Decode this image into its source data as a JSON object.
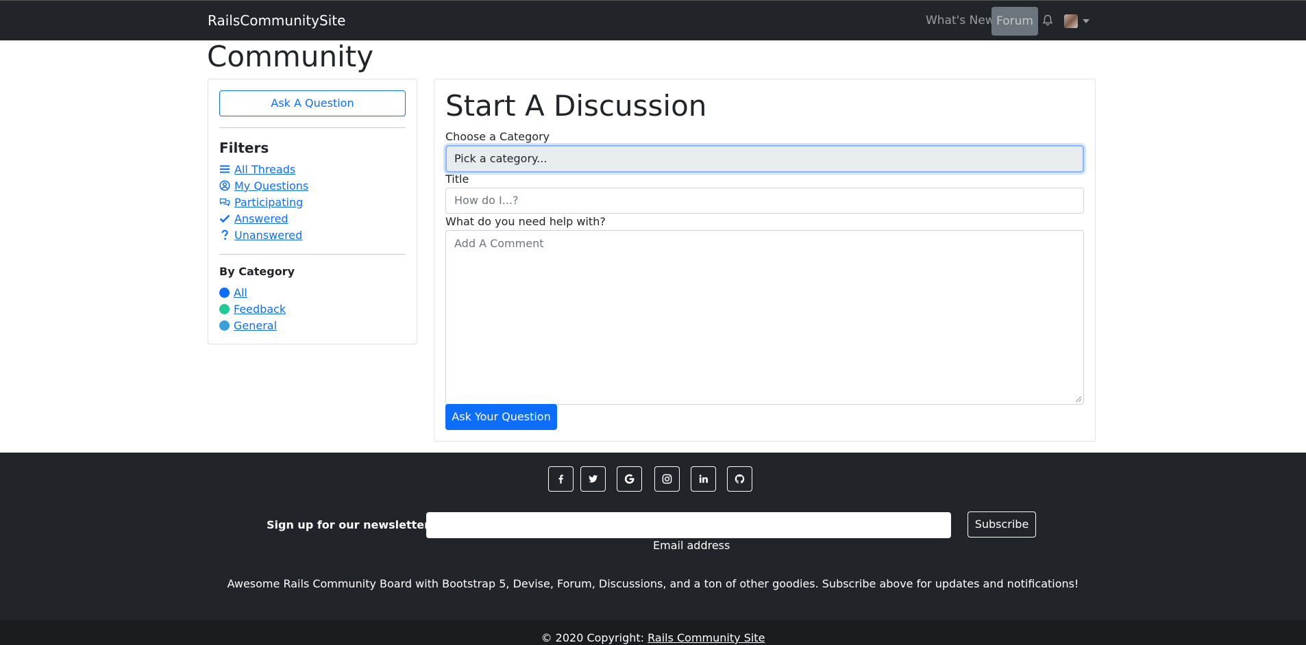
{
  "navbar": {
    "brand": "RailsCommunitySite",
    "whats_new": "What's New",
    "forum": "Forum"
  },
  "page_title": "Community",
  "sidebar": {
    "ask_button": "Ask A Question",
    "filters_title": "Filters",
    "filters": [
      {
        "label": "All Threads",
        "icon": "list-icon"
      },
      {
        "label": "My Questions",
        "icon": "user-circle-icon"
      },
      {
        "label": "Participating",
        "icon": "comments-icon"
      },
      {
        "label": "Answered",
        "icon": "check-icon"
      },
      {
        "label": "Unanswered",
        "icon": "question-icon"
      }
    ],
    "by_category_title": "By Category",
    "categories": [
      {
        "label": "All",
        "color": "#0d6efd"
      },
      {
        "label": "Feedback",
        "color": "#20c997"
      },
      {
        "label": "General",
        "color": "#3ba0d8"
      }
    ]
  },
  "form": {
    "title": "Start A Discussion",
    "category_label": "Choose a Category",
    "category_selected": "Pick a category...",
    "title_label": "Title",
    "title_placeholder": "How do I...?",
    "body_label": "What do you need help with?",
    "body_placeholder": "Add A Comment",
    "submit": "Ask Your Question"
  },
  "footer": {
    "socials": [
      "facebook-icon",
      "twitter-icon",
      "google-icon",
      "instagram-icon",
      "linkedin-icon",
      "github-icon"
    ],
    "newsletter_label": "Sign up for our newsletter",
    "email_caption": "Email address",
    "subscribe": "Subscribe",
    "tagline": "Awesome Rails Community Board with Bootstrap 5, Devise, Forum, Discussions, and a ton of other goodies. Subscribe above for updates and notifications!",
    "copyright_prefix": "© 2020 Copyright: ",
    "copyright_link": "Rails Community Site"
  },
  "colors": {
    "primary": "#0d6efd",
    "navbar_bg": "#212529",
    "footer_bg": "#212529"
  }
}
